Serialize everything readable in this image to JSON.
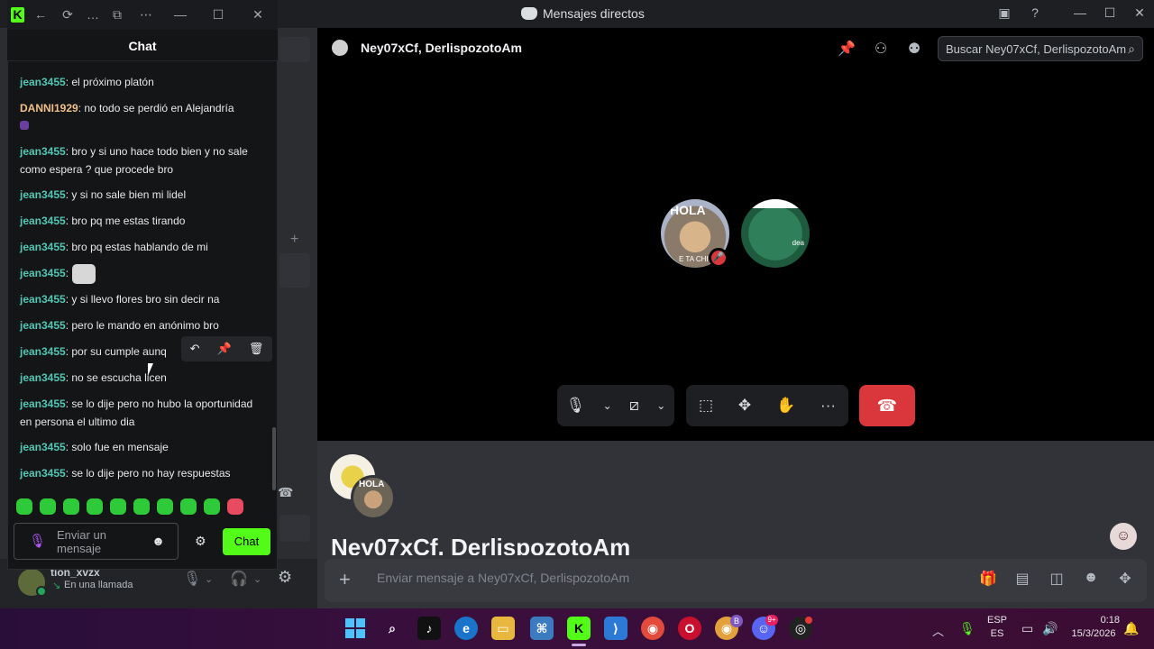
{
  "discord": {
    "window_title": "Mensajes directos",
    "header_name": "Ney07xCf, DerlispozotoAm",
    "search_placeholder": "Buscar Ney07xCf, DerlispozotoAm",
    "call_avatar_text_a": "HOLA",
    "call_avatar_sub_a": "E TA CHI",
    "call_avatar_text_b": "dea",
    "dm_title": "Ney07xCf, DerlispozotoAm",
    "dm_avatar_text": "HOLA",
    "message_placeholder": "Enviar mensaje a Ney07xCf, DerlispozotoAm",
    "user_name": "tion_xvzx",
    "user_status": "En una llamada",
    "hangup_color": "#da373c",
    "accent": "#5865f2"
  },
  "kick": {
    "header_title": "Chat",
    "input_placeholder": "Enviar un mensaje",
    "chat_button": "Chat",
    "brand_color": "#53fc18",
    "messages": [
      {
        "user": "jean3455",
        "text": ": el próximo platón"
      },
      {
        "user": "DANNI1929",
        "text": ": no todo se perdió en Alejandría"
      },
      {
        "user": "jean3455",
        "text": ": bro y si uno hace todo bien y no sale como espera ? que procede bro"
      },
      {
        "user": "jean3455",
        "text": ": y si no sale bien mi lidel"
      },
      {
        "user": "jean3455",
        "text": ": bro pq me estas tirando"
      },
      {
        "user": "jean3455",
        "text": ": bro pq estas hablando de mi"
      },
      {
        "user": "jean3455",
        "text": ":"
      },
      {
        "user": "jean3455",
        "text": ": y si llevo flores bro sin decir na"
      },
      {
        "user": "jean3455",
        "text": ": pero le mando en anónimo bro"
      },
      {
        "user": "jean3455",
        "text": ": por su cumple aunq"
      },
      {
        "user": "jean3455",
        "text": ": no se escucha licen"
      },
      {
        "user": "jean3455",
        "text": ": se lo dije pero no hubo la oportunidad en persona el ultimo dia"
      },
      {
        "user": "jean3455",
        "text": ": solo fue en mensaje"
      },
      {
        "user": "jean3455",
        "text": ": se lo dije pero no hay respuestas"
      }
    ]
  },
  "taskbar": {
    "lang_top": "ESP",
    "lang_bottom": "ES",
    "time": "0:18",
    "date": "15/3/2026",
    "discord_badge": "9+",
    "chrome_badge": "B"
  }
}
